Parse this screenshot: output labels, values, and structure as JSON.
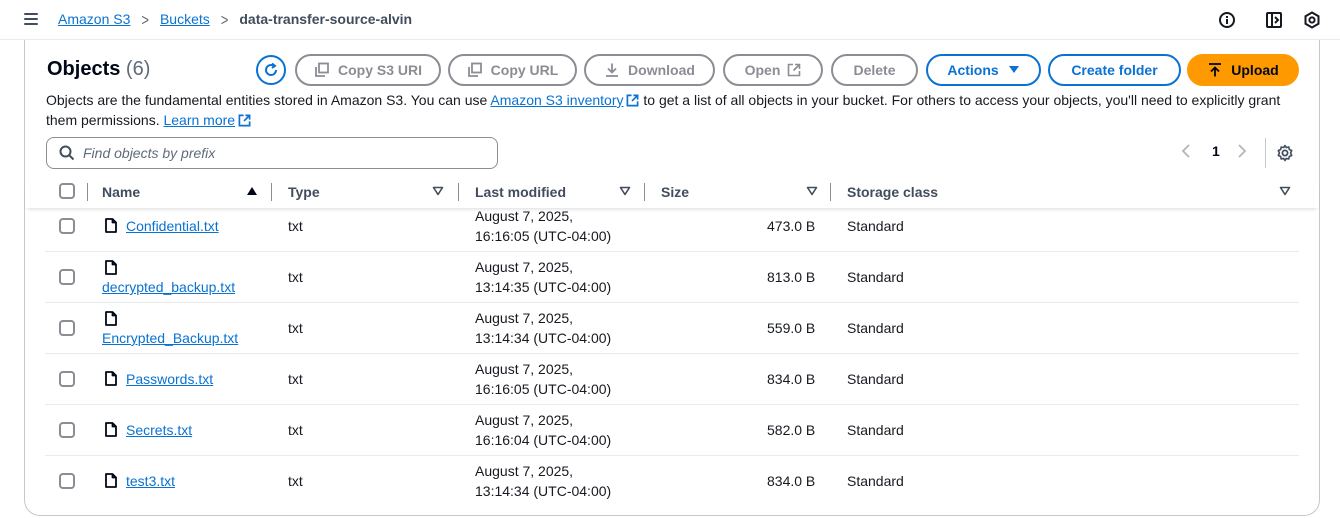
{
  "breadcrumb": {
    "items": [
      "Amazon S3",
      "Buckets"
    ],
    "current": "data-transfer-source-alvin"
  },
  "header": {
    "title": "Objects",
    "count": "(6)"
  },
  "toolbar": {
    "copy_s3_uri": "Copy S3 URI",
    "copy_url": "Copy URL",
    "download": "Download",
    "open": "Open",
    "delete": "Delete",
    "actions": "Actions",
    "create_folder": "Create folder",
    "upload": "Upload"
  },
  "description": {
    "part1": "Objects are the fundamental entities stored in Amazon S3. You can use ",
    "link1": "Amazon S3 inventory",
    "part2": " to get a list of all objects in your bucket. For others to access your objects, you'll need to explicitly grant them permissions. ",
    "link2": "Learn more"
  },
  "search": {
    "placeholder": "Find objects by prefix"
  },
  "pagination": {
    "current_page": "1"
  },
  "table": {
    "columns": [
      "Name",
      "Type",
      "Last modified",
      "Size",
      "Storage class"
    ],
    "rows": [
      {
        "name": "Confidential.txt",
        "type": "txt",
        "modified_date": "August 7, 2025,",
        "modified_time": "16:16:05 (UTC-04:00)",
        "size": "473.0 B",
        "storage": "Standard"
      },
      {
        "name": "decrypted_backup.txt",
        "type": "txt",
        "modified_date": "August 7, 2025,",
        "modified_time": "13:14:35 (UTC-04:00)",
        "size": "813.0 B",
        "storage": "Standard"
      },
      {
        "name": "Encrypted_Backup.txt",
        "type": "txt",
        "modified_date": "August 7, 2025,",
        "modified_time": "13:14:34 (UTC-04:00)",
        "size": "559.0 B",
        "storage": "Standard"
      },
      {
        "name": "Passwords.txt",
        "type": "txt",
        "modified_date": "August 7, 2025,",
        "modified_time": "16:16:05 (UTC-04:00)",
        "size": "834.0 B",
        "storage": "Standard"
      },
      {
        "name": "Secrets.txt",
        "type": "txt",
        "modified_date": "August 7, 2025,",
        "modified_time": "16:16:04 (UTC-04:00)",
        "size": "582.0 B",
        "storage": "Standard"
      },
      {
        "name": "test3.txt",
        "type": "txt",
        "modified_date": "August 7, 2025,",
        "modified_time": "13:14:34 (UTC-04:00)",
        "size": "834.0 B",
        "storage": "Standard"
      }
    ]
  },
  "colors": {
    "link": "#0972d3",
    "upload": "#ff9900",
    "disabled": "#8c8c94"
  }
}
